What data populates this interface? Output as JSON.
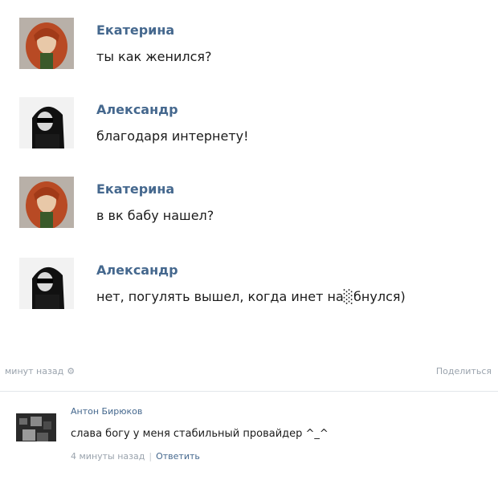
{
  "messages": [
    {
      "author": "Екатерина",
      "text": "ты как женился?",
      "avatar": "red-hair-avatar-icon"
    },
    {
      "author": "Александр",
      "text": "благодаря интернету!",
      "avatar": "sunglasses-avatar-icon"
    },
    {
      "author": "Екатерина",
      "text": "в вк бабу нашел?",
      "avatar": "red-hair-avatar-icon"
    },
    {
      "author": "Александр",
      "text": "нет, погулять вышел, когда инет на░бнулся)",
      "avatar": "sunglasses-avatar-icon"
    }
  ],
  "post_meta": {
    "time": "минут назад",
    "gear_icon": "gear-icon",
    "share": "Поделиться"
  },
  "comment": {
    "author": "Антон Бирюков",
    "text": "слава богу у меня стабильный провайдер ^_^",
    "time": "4 минуты назад",
    "separator": "|",
    "reply": "Ответить"
  },
  "colors": {
    "link": "#45688e",
    "muted": "#9aa3ad",
    "text": "#1b1b1b",
    "divider": "#e3e6ea"
  }
}
